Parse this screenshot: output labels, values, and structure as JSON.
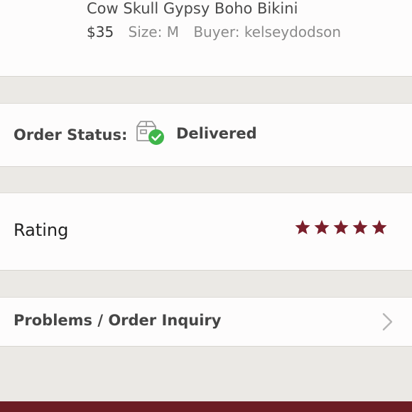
{
  "item": {
    "title": "Cow Skull Gypsy Boho Bikini",
    "price": "$35",
    "size": "Size: M",
    "buyer": "Buyer: kelseydodson"
  },
  "order_status": {
    "label": "Order Status:",
    "value": "Delivered",
    "icon": "delivered-box-icon"
  },
  "rating": {
    "label": "Rating",
    "stars": 5,
    "max_stars": 5,
    "star_color": "#7a1f2b"
  },
  "problems": {
    "label": "Problems / Order Inquiry",
    "icon": "chevron-right-icon"
  },
  "colors": {
    "accent": "#7a1f2b",
    "check_green": "#3fb54a",
    "bottom_bar": "#6c1e24"
  }
}
